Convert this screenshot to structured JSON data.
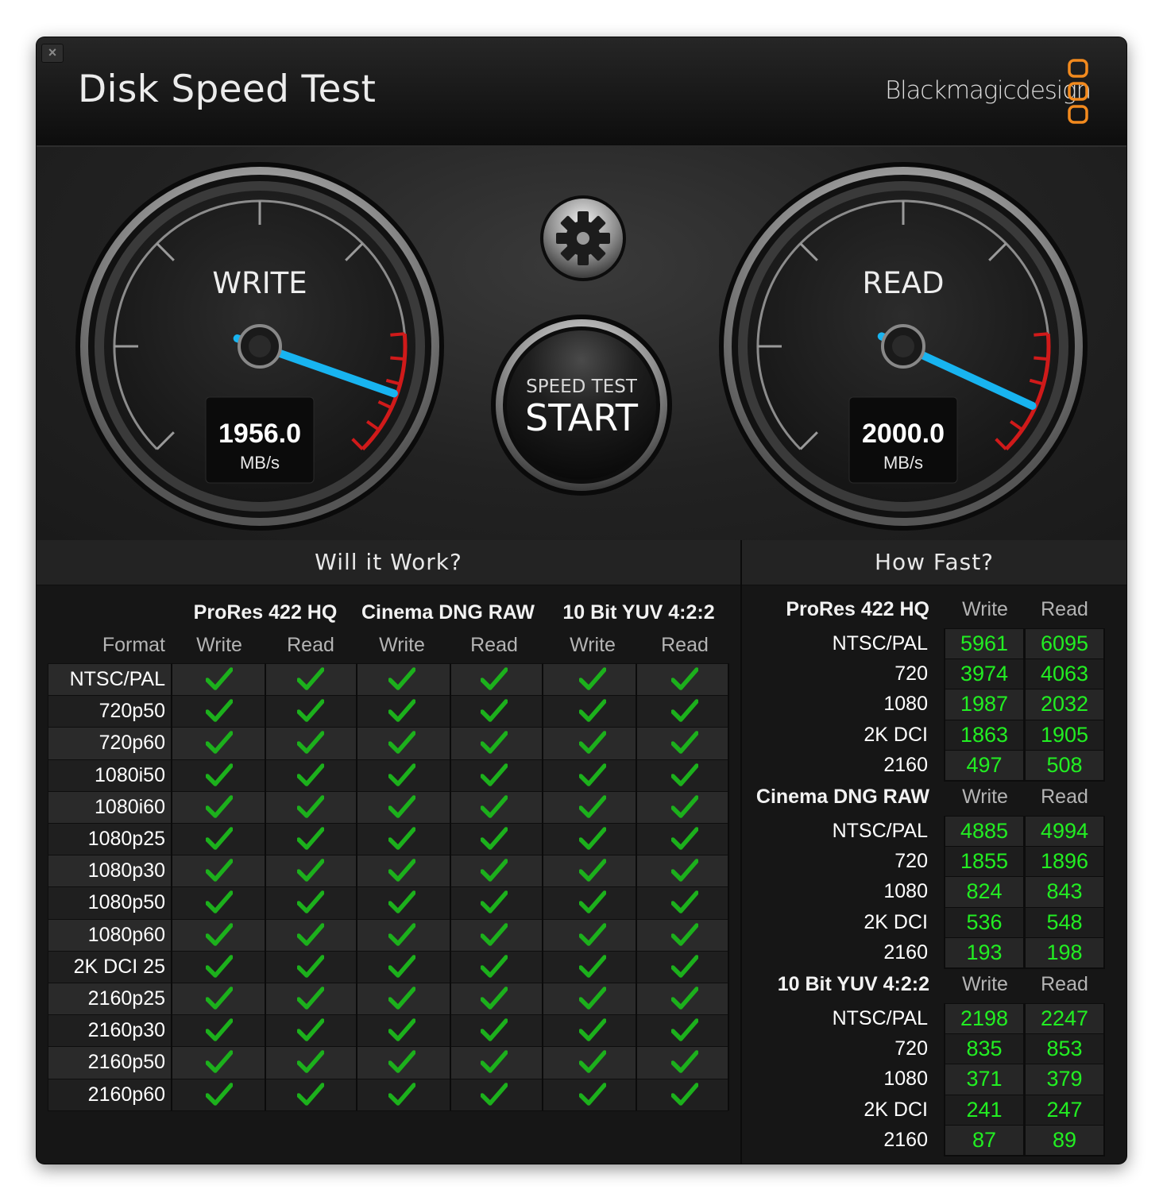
{
  "window": {
    "title": "Disk Speed Test",
    "brand": "Blackmagicdesign",
    "close_label": "×"
  },
  "colors": {
    "accent_needle": "#18b4f0",
    "redline": "#d01a1a",
    "value_green": "#22ee22",
    "check_green": "#1cb01c",
    "logo_orange": "#f28a1e"
  },
  "gauges": {
    "write": {
      "label": "WRITE",
      "value": "1956.0",
      "unit": "MB/s",
      "needle_fraction": 0.905
    },
    "read": {
      "label": "READ",
      "value": "2000.0",
      "unit": "MB/s",
      "needle_fraction": 0.925
    }
  },
  "start_button": {
    "line1": "SPEED TEST",
    "line2": "START"
  },
  "settings_button": {
    "icon": "gear-icon"
  },
  "will_it_work": {
    "title": "Will it Work?",
    "format_header": "Format",
    "codecs": [
      "ProRes 422 HQ",
      "Cinema DNG RAW",
      "10 Bit YUV 4:2:2"
    ],
    "sub_headers": [
      "Write",
      "Read",
      "Write",
      "Read",
      "Write",
      "Read"
    ],
    "formats": [
      "NTSC/PAL",
      "720p50",
      "720p60",
      "1080i50",
      "1080i60",
      "1080p25",
      "1080p30",
      "1080p50",
      "1080p60",
      "2K DCI 25",
      "2160p25",
      "2160p30",
      "2160p50",
      "2160p60"
    ],
    "supported": [
      [
        true,
        true,
        true,
        true,
        true,
        true
      ],
      [
        true,
        true,
        true,
        true,
        true,
        true
      ],
      [
        true,
        true,
        true,
        true,
        true,
        true
      ],
      [
        true,
        true,
        true,
        true,
        true,
        true
      ],
      [
        true,
        true,
        true,
        true,
        true,
        true
      ],
      [
        true,
        true,
        true,
        true,
        true,
        true
      ],
      [
        true,
        true,
        true,
        true,
        true,
        true
      ],
      [
        true,
        true,
        true,
        true,
        true,
        true
      ],
      [
        true,
        true,
        true,
        true,
        true,
        true
      ],
      [
        true,
        true,
        true,
        true,
        true,
        true
      ],
      [
        true,
        true,
        true,
        true,
        true,
        true
      ],
      [
        true,
        true,
        true,
        true,
        true,
        true
      ],
      [
        true,
        true,
        true,
        true,
        true,
        true
      ],
      [
        true,
        true,
        true,
        true,
        true,
        true
      ]
    ]
  },
  "how_fast": {
    "title": "How Fast?",
    "groups": [
      {
        "codec": "ProRes 422 HQ",
        "write_label": "Write",
        "read_label": "Read",
        "rows": [
          {
            "format": "NTSC/PAL",
            "write": "5961",
            "read": "6095"
          },
          {
            "format": "720",
            "write": "3974",
            "read": "4063"
          },
          {
            "format": "1080",
            "write": "1987",
            "read": "2032"
          },
          {
            "format": "2K DCI",
            "write": "1863",
            "read": "1905"
          },
          {
            "format": "2160",
            "write": "497",
            "read": "508"
          }
        ]
      },
      {
        "codec": "Cinema DNG RAW",
        "write_label": "Write",
        "read_label": "Read",
        "rows": [
          {
            "format": "NTSC/PAL",
            "write": "4885",
            "read": "4994"
          },
          {
            "format": "720",
            "write": "1855",
            "read": "1896"
          },
          {
            "format": "1080",
            "write": "824",
            "read": "843"
          },
          {
            "format": "2K DCI",
            "write": "536",
            "read": "548"
          },
          {
            "format": "2160",
            "write": "193",
            "read": "198"
          }
        ]
      },
      {
        "codec": "10 Bit YUV 4:2:2",
        "write_label": "Write",
        "read_label": "Read",
        "rows": [
          {
            "format": "NTSC/PAL",
            "write": "2198",
            "read": "2247"
          },
          {
            "format": "720",
            "write": "835",
            "read": "853"
          },
          {
            "format": "1080",
            "write": "371",
            "read": "379"
          },
          {
            "format": "2K DCI",
            "write": "241",
            "read": "247"
          },
          {
            "format": "2160",
            "write": "87",
            "read": "89"
          }
        ]
      }
    ]
  }
}
